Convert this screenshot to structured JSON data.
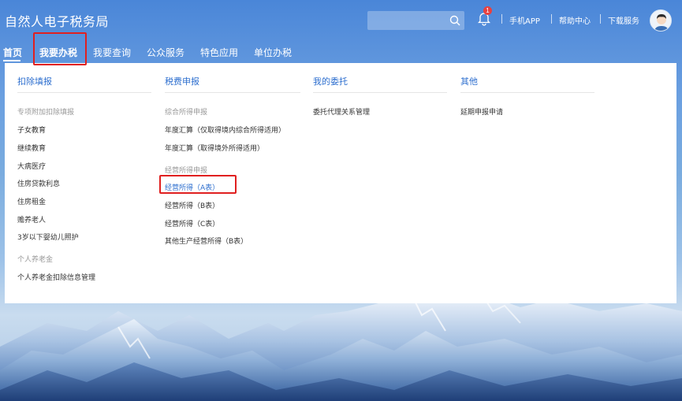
{
  "header": {
    "logo": "自然人电子税务局",
    "search": {
      "placeholder": ""
    },
    "notification_count": "1",
    "links": [
      "手机APP",
      "帮助中心",
      "下载服务"
    ]
  },
  "nav": {
    "items": [
      "首页",
      "我要办税",
      "我要查询",
      "公众服务",
      "特色应用",
      "单位办税"
    ],
    "active_index": 0,
    "highlighted_index": 1
  },
  "menu": {
    "columns": [
      {
        "title": "扣除填报",
        "groups": [
          {
            "label": "专项附加扣除填报",
            "items": [
              "子女教育",
              "继续教育",
              "大病医疗",
              "住房贷款利息",
              "住房租金",
              "赡养老人",
              "3岁以下婴幼儿照护"
            ]
          },
          {
            "label": "个人养老金",
            "items": [
              "个人养老金扣除信息管理"
            ]
          }
        ]
      },
      {
        "title": "税费申报",
        "groups": [
          {
            "label": "综合所得申报",
            "items": [
              "年度汇算（仅取得境内综合所得适用）",
              "年度汇算（取得境外所得适用）"
            ]
          },
          {
            "label": "经营所得申报",
            "items": [
              "经营所得（A表）",
              "经营所得（B表）",
              "经营所得（C表）",
              "其他生产经营所得（B表）"
            ]
          }
        ]
      },
      {
        "title": "我的委托",
        "groups": [
          {
            "label": "",
            "items": [
              "委托代理关系管理"
            ]
          }
        ]
      },
      {
        "title": "其他",
        "groups": [
          {
            "label": "",
            "items": [
              "延期申报申请"
            ]
          }
        ]
      }
    ],
    "active_item": "经营所得（A表）"
  },
  "colors": {
    "header_blue": "#4a86d8",
    "link_blue": "#2e6fcf",
    "highlight_red": "#e02020"
  }
}
